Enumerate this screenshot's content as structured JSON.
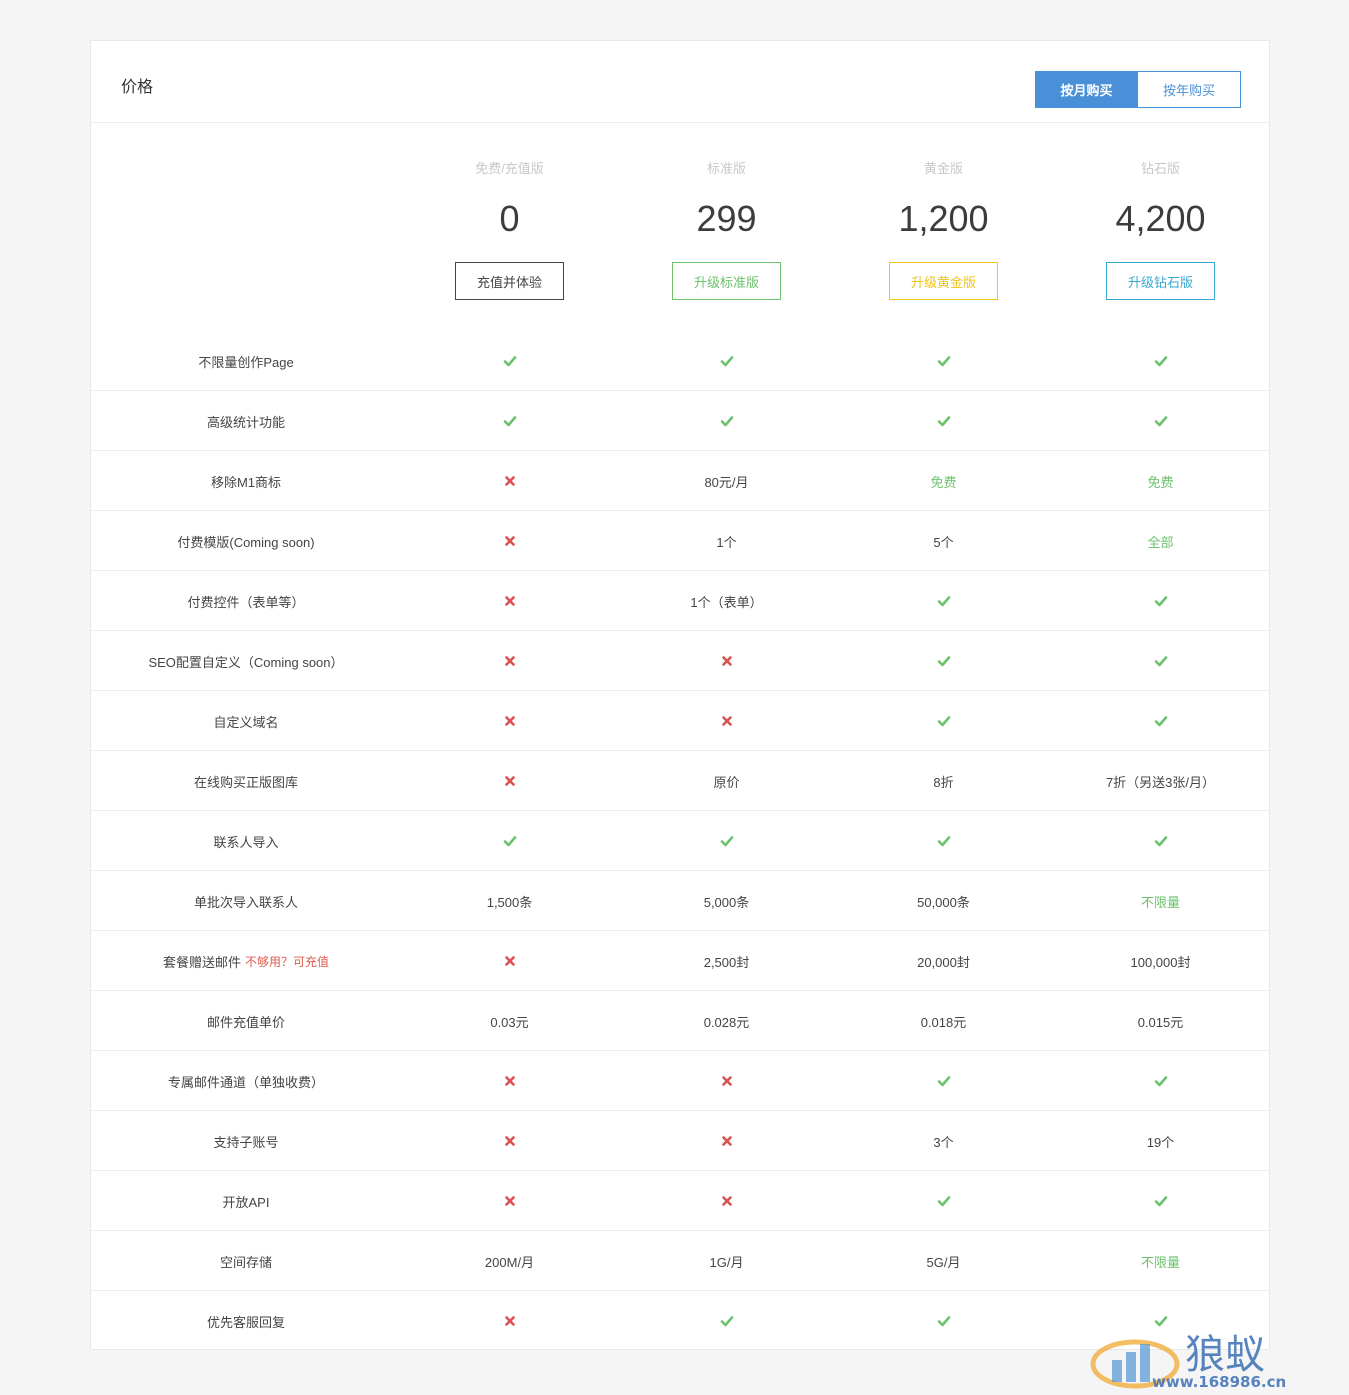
{
  "header": {
    "title": "价格",
    "toggle": {
      "monthly": "按月购买",
      "yearly": "按年购买"
    }
  },
  "plans": [
    {
      "name": "免费/充值版",
      "price": "0",
      "button": "充值并体验",
      "color": "#444444"
    },
    {
      "name": "标准版",
      "price": "299",
      "button": "升级标准版",
      "color": "#6cc26b"
    },
    {
      "name": "黄金版",
      "price": "1,200",
      "button": "升级黄金版",
      "color": "#f0c419"
    },
    {
      "name": "钻石版",
      "price": "4,200",
      "button": "升级钻石版",
      "color": "#3aa9cf"
    }
  ],
  "rows": [
    {
      "label": "不限量创作Page",
      "values": [
        "✓",
        "✓",
        "✓",
        "✓"
      ]
    },
    {
      "label": "高级统计功能",
      "values": [
        "✓",
        "✓",
        "✓",
        "✓"
      ]
    },
    {
      "label": "移除M1商标",
      "values": [
        "✗",
        "80元/月",
        "免费",
        "免费"
      ]
    },
    {
      "label": "付费模版(Coming soon)",
      "values": [
        "✗",
        "1个",
        "5个",
        "全部"
      ]
    },
    {
      "label": "付费控件（表单等）",
      "values": [
        "✗",
        "1个（表单）",
        "✓",
        "✓"
      ]
    },
    {
      "label": "SEO配置自定义（Coming soon）",
      "values": [
        "✗",
        "✗",
        "✓",
        "✓"
      ]
    },
    {
      "label": "自定义域名",
      "values": [
        "✗",
        "✗",
        "✓",
        "✓"
      ]
    },
    {
      "label": "在线购买正版图库",
      "values": [
        "✗",
        "原价",
        "8折",
        "7折（另送3张/月）"
      ]
    },
    {
      "label": "联系人导入",
      "values": [
        "✓",
        "✓",
        "✓",
        "✓"
      ]
    },
    {
      "label": "单批次导入联系人",
      "values": [
        "1,500条",
        "5,000条",
        "50,000条",
        "不限量"
      ]
    },
    {
      "label": "套餐赠送邮件",
      "note": "不够用？可充值",
      "values": [
        "✗",
        "2,500封",
        "20,000封",
        "100,000封"
      ]
    },
    {
      "label": "邮件充值单价",
      "values": [
        "0.03元",
        "0.028元",
        "0.018元",
        "0.015元"
      ]
    },
    {
      "label": "专属邮件通道（单独收费）",
      "values": [
        "✗",
        "✗",
        "✓",
        "✓"
      ]
    },
    {
      "label": "支持子账号",
      "values": [
        "✗",
        "✗",
        "3个",
        "19个"
      ]
    },
    {
      "label": "开放API",
      "values": [
        "✗",
        "✗",
        "✓",
        "✓"
      ]
    },
    {
      "label": "空间存储",
      "values": [
        "200M/月",
        "1G/月",
        "5G/月",
        "不限量"
      ]
    },
    {
      "label": "优先客服回复",
      "values": [
        "✗",
        "✓",
        "✓",
        "✓"
      ]
    }
  ],
  "highlight_values": [
    "免费",
    "全部",
    "不限量"
  ],
  "colors": {
    "accent": "#4a90d9",
    "check": "#6cc26b",
    "cross": "#d9534f",
    "note": "#e05a4e"
  },
  "watermark": {
    "brand": "狼蚁",
    "url": "www.168986.cn"
  }
}
